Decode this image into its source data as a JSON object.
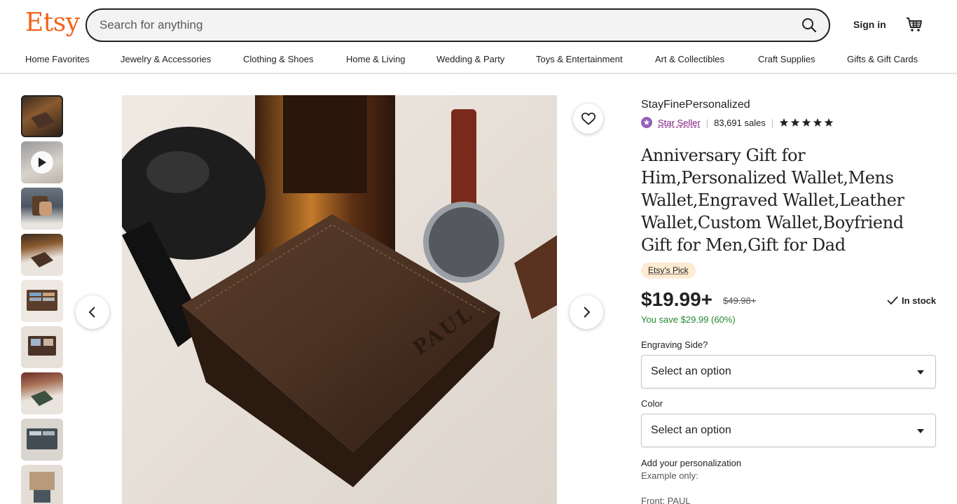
{
  "header": {
    "logo": "Etsy",
    "search_placeholder": "Search for anything",
    "signin_label": "Sign in"
  },
  "nav": {
    "items": [
      "Home Favorites",
      "Jewelry & Accessories",
      "Clothing & Shoes",
      "Home & Living",
      "Wedding & Party",
      "Toys & Entertainment",
      "Art & Collectibles",
      "Craft Supplies",
      "Gifts & Gift Cards"
    ]
  },
  "gallery": {
    "thumbnail_count": 9,
    "active_index": 0,
    "video_thumbnail_index": 1,
    "engraving_text": "PAUL"
  },
  "listing": {
    "shop_name": "StayFinePersonalized",
    "star_seller_label": "Star Seller",
    "sales": "83,691 sales",
    "rating_stars": 5,
    "title": "Anniversary Gift for Him,Personalized Wallet,Mens Wallet,Engraved Wallet,Leather Wallet,Custom Wallet,Boyfriend Gift for Men,Gift for Dad",
    "badge": "Etsy's Pick",
    "price": "$19.99+",
    "original_price": "$49.98+",
    "stock_status": "In stock",
    "savings": "You save $29.99 (60%)"
  },
  "options": {
    "engraving_label": "Engraving Side?",
    "engraving_value": "Select an option",
    "color_label": "Color",
    "color_value": "Select an option",
    "personalization_label": "Add your personalization",
    "example_label": "Example only:",
    "front_example": "Front: PAUL"
  },
  "colors": {
    "brand": "#F1641E",
    "star_seller": "#7F187F",
    "savings": "#258635",
    "pick_badge": "#FDEBD2"
  }
}
